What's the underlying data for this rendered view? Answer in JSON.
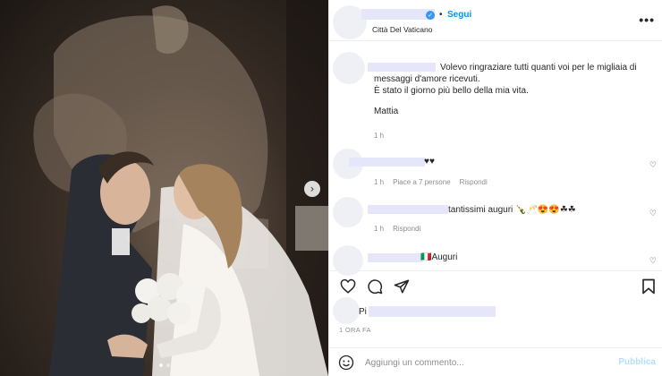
{
  "post": {
    "location": "Città Del Vaticano",
    "follow_label": "Segui",
    "verified_icon": "✓",
    "sep": "•",
    "more": "•••"
  },
  "caption": {
    "line1": "Volevo ringraziare tutti quanti voi per le migliaia di messaggi d'amore ricevuti.",
    "line2": "È stato il giorno più bello della mia vita.",
    "line3": "Mattia",
    "time": "1 h"
  },
  "comments": [
    {
      "text": "♥♥",
      "time": "1 h",
      "likes": "Piace a 7 persone",
      "reply": "Rispondi"
    },
    {
      "text": "tantissimi auguri 🍾🥂😍😍☘☘",
      "time": "1 h",
      "reply": "Rispondi"
    },
    {
      "text": "🇮🇹Auguri",
      "time": "",
      "reply": ""
    }
  ],
  "likes": {
    "prefix": "Pi"
  },
  "date": "1 ORA FA",
  "add_comment": {
    "placeholder": "Aggiungi un commento...",
    "publish": "Pubblica"
  },
  "photo": {
    "next": "›",
    "dots": 2
  }
}
